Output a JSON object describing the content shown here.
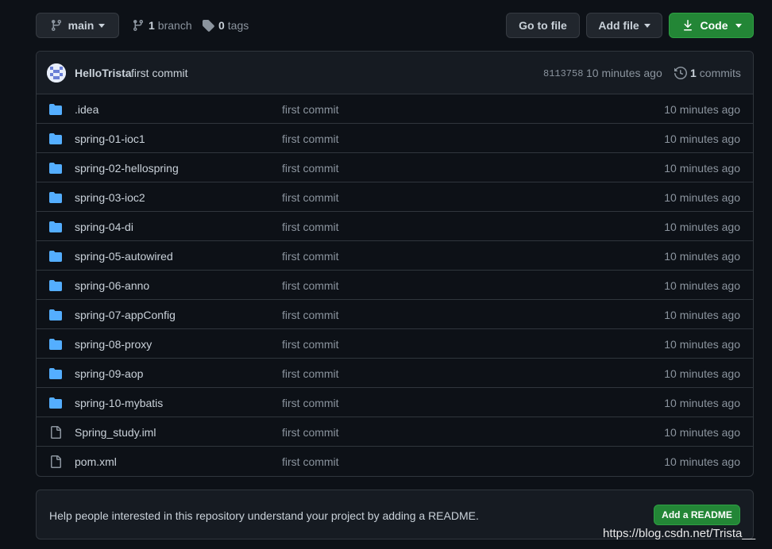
{
  "toolbar": {
    "branch_name": "main",
    "branch_count": "1",
    "branch_label": "branch",
    "tag_count": "0",
    "tag_label": "tags",
    "goto_file_label": "Go to file",
    "add_file_label": "Add file",
    "code_label": "Code"
  },
  "latest_commit": {
    "author": "HelloTrista",
    "message": "first commit",
    "sha": "8113758",
    "time": "10 minutes ago",
    "commit_count": "1",
    "commit_label": "commits"
  },
  "files": [
    {
      "name": ".idea",
      "type": "dir",
      "message": "first commit",
      "time": "10 minutes ago"
    },
    {
      "name": "spring-01-ioc1",
      "type": "dir",
      "message": "first commit",
      "time": "10 minutes ago"
    },
    {
      "name": "spring-02-hellospring",
      "type": "dir",
      "message": "first commit",
      "time": "10 minutes ago"
    },
    {
      "name": "spring-03-ioc2",
      "type": "dir",
      "message": "first commit",
      "time": "10 minutes ago"
    },
    {
      "name": "spring-04-di",
      "type": "dir",
      "message": "first commit",
      "time": "10 minutes ago"
    },
    {
      "name": "spring-05-autowired",
      "type": "dir",
      "message": "first commit",
      "time": "10 minutes ago"
    },
    {
      "name": "spring-06-anno",
      "type": "dir",
      "message": "first commit",
      "time": "10 minutes ago"
    },
    {
      "name": "spring-07-appConfig",
      "type": "dir",
      "message": "first commit",
      "time": "10 minutes ago"
    },
    {
      "name": "spring-08-proxy",
      "type": "dir",
      "message": "first commit",
      "time": "10 minutes ago"
    },
    {
      "name": "spring-09-aop",
      "type": "dir",
      "message": "first commit",
      "time": "10 minutes ago"
    },
    {
      "name": "spring-10-mybatis",
      "type": "dir",
      "message": "first commit",
      "time": "10 minutes ago"
    },
    {
      "name": "Spring_study.iml",
      "type": "file",
      "message": "first commit",
      "time": "10 minutes ago"
    },
    {
      "name": "pom.xml",
      "type": "file",
      "message": "first commit",
      "time": "10 minutes ago"
    }
  ],
  "readme": {
    "prompt": "Help people interested in this repository understand your project by adding a README.",
    "button_label": "Add a README"
  },
  "watermark": "https://blog.csdn.net/Trista__",
  "colors": {
    "background": "#0d1117",
    "panel": "#161b22",
    "border": "#30363d",
    "folder": "#54aeff",
    "primary_button": "#238636",
    "muted_text": "#8b949e"
  }
}
